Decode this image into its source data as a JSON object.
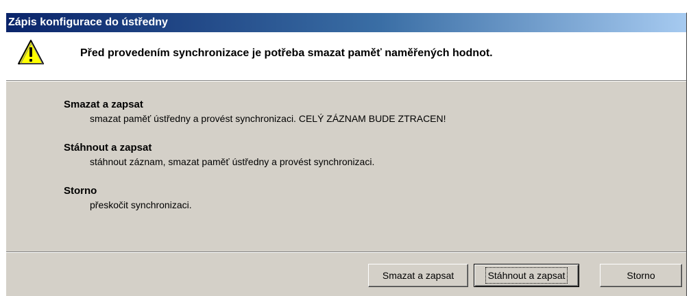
{
  "dialog": {
    "title": "Zápis konfigurace do ústředny",
    "header_message": "Před provedením synchronizace je potřeba smazat paměť naměřených hodnot.",
    "icon": "warning-icon",
    "options": [
      {
        "title": "Smazat a zapsat",
        "description": "smazat paměť ústředny a provést synchronizaci. CELÝ ZÁZNAM BUDE ZTRACEN!"
      },
      {
        "title": "Stáhnout a zapsat",
        "description": "stáhnout záznam, smazat paměť ústředny a provést synchronizaci."
      },
      {
        "title": "Storno",
        "description": "přeskočit synchronizaci."
      }
    ],
    "buttons": {
      "delete_write": "Smazat a zapsat",
      "download_write": "Stáhnout a zapsat",
      "cancel": "Storno"
    },
    "colors": {
      "title_bar_start": "#0a246a",
      "title_bar_end": "#a6caf0",
      "dialog_face": "#d4d0c8",
      "warning_yellow": "#ffff00"
    }
  }
}
